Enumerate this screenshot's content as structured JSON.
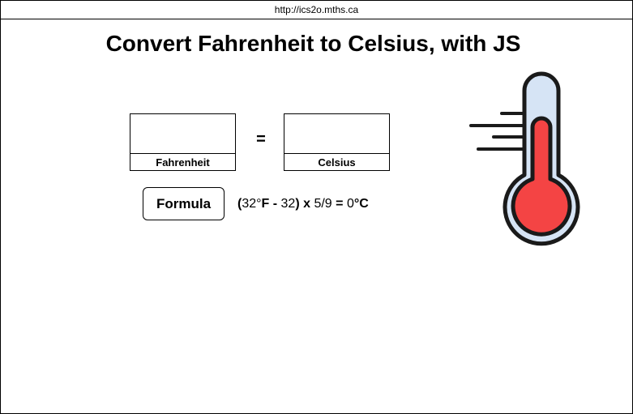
{
  "browser": {
    "url": "http://ics2o.mths.ca"
  },
  "page": {
    "title": "Convert Fahrenheit to Celsius, with JS"
  },
  "converter": {
    "fahrenheit": {
      "label": "Fahrenheit",
      "value": ""
    },
    "equals_sign": "=",
    "celsius": {
      "label": "Celsius",
      "value": ""
    },
    "formula_button_label": "Formula",
    "formula": {
      "open_paren": "(",
      "f_value": "32°",
      "f_unit": "F",
      "minus": " - ",
      "subtract": "32",
      "close_paren": ")",
      "times": " x ",
      "ratio": "5/9",
      "equals": " = ",
      "c_value": "0",
      "c_unit": "°C"
    }
  },
  "thermometer": {
    "icon": "thermometer-icon",
    "colors": {
      "outline": "#1a1a1a",
      "tube_fill": "#d6e4f5",
      "mercury": "#f44444"
    }
  }
}
